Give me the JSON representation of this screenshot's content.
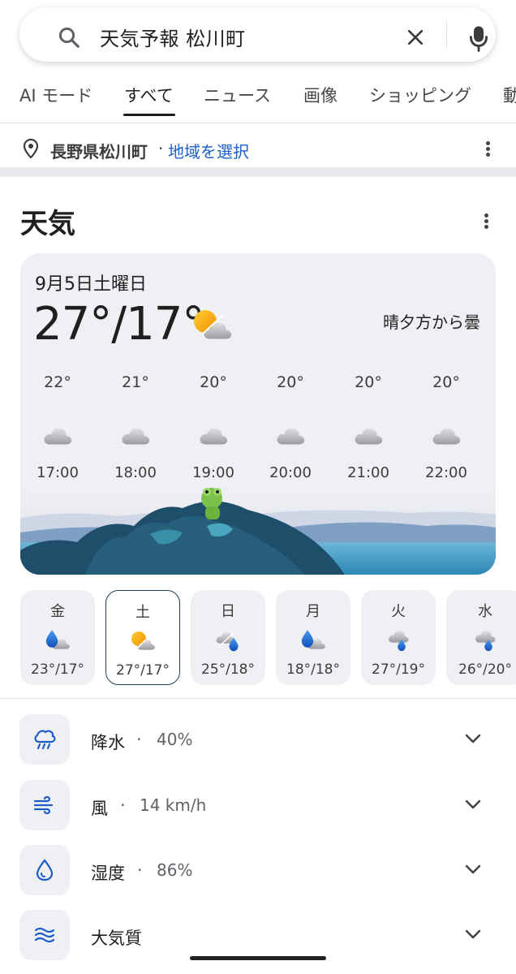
{
  "search": {
    "query": "天気予報 松川町"
  },
  "tabs": [
    {
      "label": "AI モード"
    },
    {
      "label": "すべて"
    },
    {
      "label": "ニュース"
    },
    {
      "label": "画像"
    },
    {
      "label": "ショッピング"
    },
    {
      "label": "動"
    }
  ],
  "location": {
    "place": "長野県松川町",
    "separator": "·",
    "link": "地域を選択"
  },
  "weather": {
    "title": "天気",
    "date": "9月5日土曜日",
    "temp": "27°/17°",
    "condition": "晴夕方から曇",
    "hourly": [
      {
        "temp": "22°",
        "time": "17:00",
        "icon": "cloud"
      },
      {
        "temp": "21°",
        "time": "18:00",
        "icon": "cloud"
      },
      {
        "temp": "20°",
        "time": "19:00",
        "icon": "cloud"
      },
      {
        "temp": "20°",
        "time": "20:00",
        "icon": "cloud"
      },
      {
        "temp": "20°",
        "time": "21:00",
        "icon": "cloud"
      },
      {
        "temp": "20°",
        "time": "22:00",
        "icon": "cloud"
      }
    ],
    "daily": [
      {
        "day": "金",
        "temps": "23°/17°",
        "icon": "rain-cloud"
      },
      {
        "day": "土",
        "temps": "27°/17°",
        "icon": "sun-cloud",
        "selected": true
      },
      {
        "day": "日",
        "temps": "25°/18°",
        "icon": "cloud-rain"
      },
      {
        "day": "月",
        "temps": "18°/18°",
        "icon": "rain-cloud"
      },
      {
        "day": "火",
        "temps": "27°/19°",
        "icon": "cloud-drop"
      },
      {
        "day": "水",
        "temps": "26°/20°",
        "icon": "cloud-drop"
      }
    ]
  },
  "metrics": [
    {
      "label": "降水",
      "sep": "·",
      "value": "40%",
      "icon": "rain-icon"
    },
    {
      "label": "風",
      "sep": "·",
      "value": "14 km/h",
      "icon": "wind-icon"
    },
    {
      "label": "湿度",
      "sep": "·",
      "value": "86%",
      "icon": "humidity-icon"
    },
    {
      "label": "大気質",
      "sep": "",
      "value": "",
      "icon": "air-quality-icon"
    }
  ],
  "colors": {
    "accent_blue": "#1a5fc8",
    "card_bg": "#eff0f4",
    "selected_border": "#1b3f5e",
    "icon_blue": "#1e5cc8"
  }
}
